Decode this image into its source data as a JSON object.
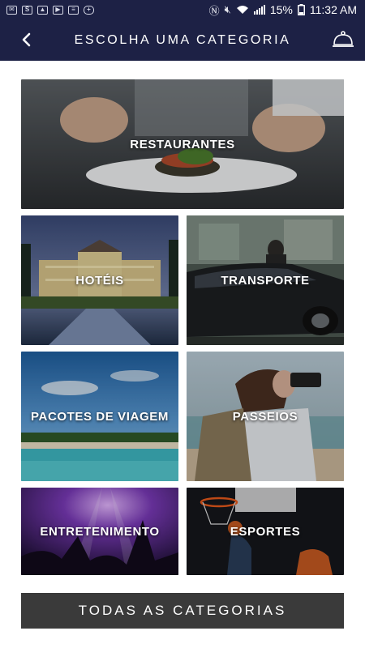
{
  "status_bar": {
    "battery": "15%",
    "time": "11:32 AM",
    "left_icons": [
      "mail-icon",
      "skype-icon",
      "gallery-icon",
      "youtube-icon",
      "clipboard-icon",
      "gamepad-icon"
    ],
    "right_icons": [
      "nfc-icon",
      "mute-icon",
      "wifi-icon",
      "signal-icon",
      "battery-icon"
    ]
  },
  "header": {
    "title": "ESCOLHA UMA CATEGORIA",
    "back_icon": "back-chevron-icon",
    "action_icon": "service-bell-icon"
  },
  "categories": [
    {
      "label": "RESTAURANTES"
    },
    {
      "label": "HOTÉIS"
    },
    {
      "label": "TRANSPORTE"
    },
    {
      "label": "PACOTES DE VIAGEM"
    },
    {
      "label": "PASSEIOS"
    },
    {
      "label": "ENTRETENIMENTO"
    },
    {
      "label": "ESPORTES"
    }
  ],
  "all_categories_button": "TODAS AS CATEGORIAS",
  "colors": {
    "header_bg": "#1d2145",
    "button_bg": "#3a3a3a",
    "label_text": "#ffffff"
  }
}
